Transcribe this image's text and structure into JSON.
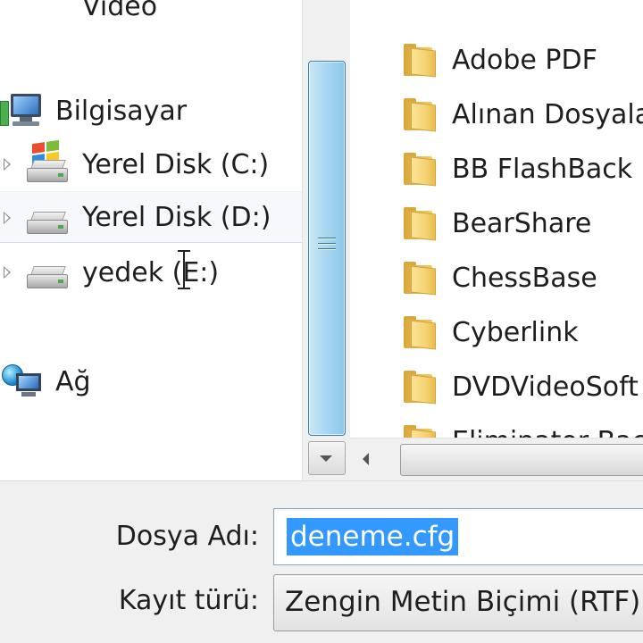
{
  "navigation": {
    "partial_item": {
      "label": "Video",
      "icon": "video-library-icon"
    },
    "items": [
      {
        "label": "Bilgisayar",
        "icon": "computer-icon"
      },
      {
        "label": "Yerel Disk (C:)",
        "icon": "windows-drive-icon"
      },
      {
        "label": "Yerel Disk (D:)",
        "icon": "drive-icon"
      },
      {
        "label": "yedek (E:)",
        "icon": "drive-icon"
      },
      {
        "label": "Ağ",
        "icon": "network-icon"
      }
    ]
  },
  "folders": [
    "Adobe PDF",
    "Alınan Dosyalar",
    "BB FlashBack Express",
    "BearShare",
    "ChessBase",
    "Cyberlink",
    "DVDVideoSoft",
    "Eliminator Backup"
  ],
  "form": {
    "filename_label": "Dosya Adı:",
    "filename_value": "deneme.cfg",
    "type_label": "Kayıt türü:",
    "type_value": "Zengin Metin Biçimi (RTF)"
  },
  "colors": {
    "selection": "#3399ff",
    "scroll_thumb": "#a8d6f1",
    "folder": "#f5d272",
    "form_background": "#f0f0f0"
  }
}
